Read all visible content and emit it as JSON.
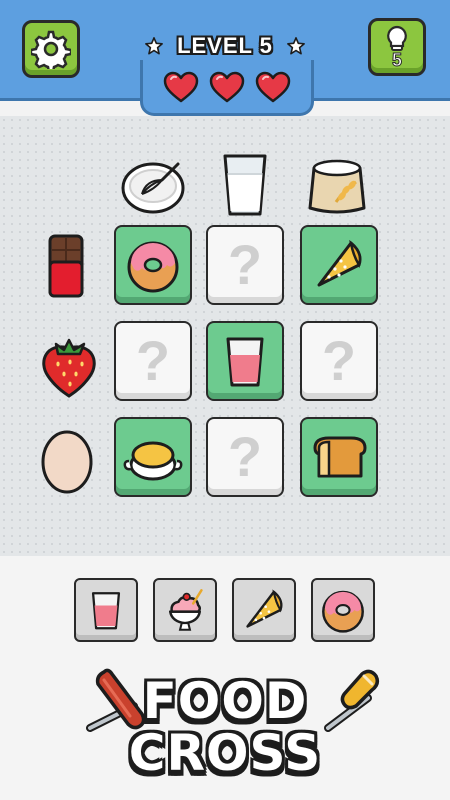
{
  "header": {
    "level_label": "LEVEL 5",
    "hints_remaining": "5",
    "lives": 3,
    "colors": {
      "bar": "#5d9fe0",
      "button": "#8cc63f",
      "heart": "#e63946"
    }
  },
  "board": {
    "column_items": [
      "whisk-bowl-icon",
      "milk-glass-icon",
      "flour-sack-icon"
    ],
    "row_items": [
      "chocolate-bar-icon",
      "strawberry-icon",
      "egg-icon"
    ],
    "cells": [
      [
        {
          "state": "filled",
          "item": "donut-icon"
        },
        {
          "state": "empty",
          "label": "?"
        },
        {
          "state": "filled",
          "item": "crepe-icon"
        }
      ],
      [
        {
          "state": "empty",
          "label": "?"
        },
        {
          "state": "filled",
          "item": "strawberry-milk-icon"
        },
        {
          "state": "empty",
          "label": "?"
        }
      ],
      [
        {
          "state": "filled",
          "item": "custard-pot-icon"
        },
        {
          "state": "empty",
          "label": "?"
        },
        {
          "state": "filled",
          "item": "bread-loaf-icon"
        }
      ]
    ]
  },
  "tray": {
    "items": [
      "strawberry-milk-icon",
      "strawberry-ice-cream-icon",
      "crepe-icon",
      "donut-icon"
    ]
  },
  "logo": {
    "line1": "FOOD",
    "line2": "CROSS"
  }
}
